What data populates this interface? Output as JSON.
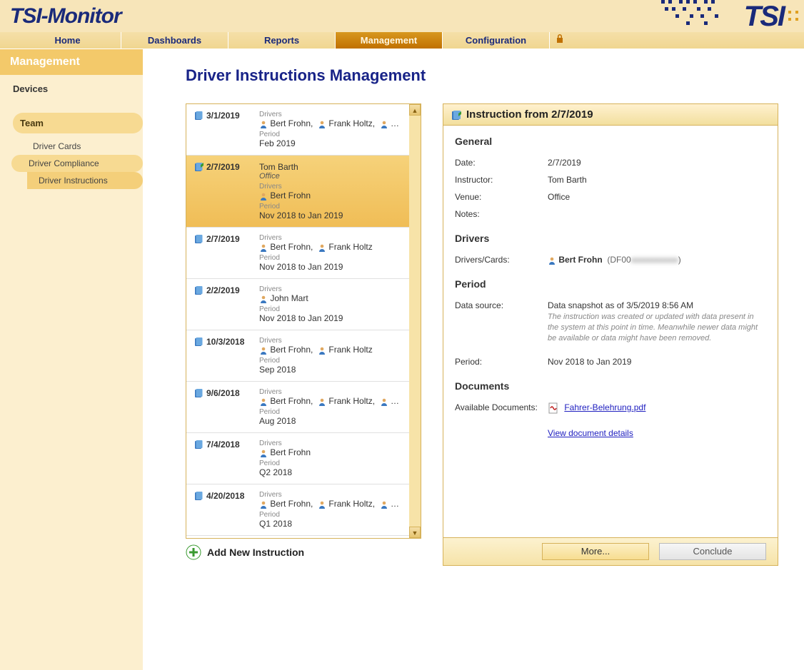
{
  "app": {
    "title": "TSI-Monitor",
    "logo_text": "TSI"
  },
  "nav": {
    "home": "Home",
    "dashboards": "Dashboards",
    "reports": "Reports",
    "management": "Management",
    "configuration": "Configuration"
  },
  "sidebar": {
    "heading": "Management",
    "devices": "Devices",
    "team": "Team",
    "driver_cards": "Driver Cards",
    "driver_compliance": "Driver Compliance",
    "driver_instructions": "Driver Instructions"
  },
  "page": {
    "title": "Driver Instructions Management"
  },
  "list": {
    "drivers_label": "Drivers",
    "period_label": "Period",
    "items": [
      {
        "date": "3/1/2019",
        "drivers": "Bert Frohn,   Frank Holtz,   …",
        "period": "Feb 2019"
      },
      {
        "date": "2/7/2019",
        "instructor": "Tom Barth",
        "venue": "Office",
        "drivers": "Bert Frohn",
        "period": "Nov 2018 to Jan 2019",
        "selected": true
      },
      {
        "date": "2/7/2019",
        "drivers": "Bert Frohn,   Frank Holtz",
        "period": "Nov 2018 to Jan 2019"
      },
      {
        "date": "2/2/2019",
        "drivers": "John Mart",
        "period": "Nov 2018 to Jan 2019"
      },
      {
        "date": "10/3/2018",
        "drivers": "Bert Frohn,   Frank Holtz",
        "period": "Sep 2018"
      },
      {
        "date": "9/6/2018",
        "drivers": "Bert Frohn,   Frank Holtz,   …",
        "period": "Aug 2018"
      },
      {
        "date": "7/4/2018",
        "drivers": "Bert Frohn",
        "period": "Q2 2018"
      },
      {
        "date": "4/20/2018",
        "drivers": "Bert Frohn,   Frank Holtz,   …",
        "period": "Q1 2018"
      }
    ],
    "add_label": "Add New Instruction"
  },
  "detail": {
    "title": "Instruction from 2/7/2019",
    "general_heading": "General",
    "date_label": "Date:",
    "date_value": "2/7/2019",
    "instructor_label": "Instructor:",
    "instructor_value": "Tom Barth",
    "venue_label": "Venue:",
    "venue_value": "Office",
    "notes_label": "Notes:",
    "notes_value": "",
    "drivers_heading": "Drivers",
    "driverscards_label": "Drivers/Cards:",
    "driver_name": "Bert Frohn",
    "driver_card": "(DF00xxxxxxxxxxx)",
    "period_heading": "Period",
    "datasource_label": "Data source:",
    "datasource_value": "Data snapshot as of 3/5/2019 8:56 AM",
    "datasource_hint": "The instruction was created or updated with data present in the system at this point in time. Meanwhile newer data might be available or data might have been removed.",
    "period_label": "Period:",
    "period_value": "Nov 2018 to Jan 2019",
    "documents_heading": "Documents",
    "available_label": "Available Documents:",
    "doc_name": "Fahrer-Belehrung.pdf",
    "view_details": "View document details",
    "btn_more": "More...",
    "btn_conclude": "Conclude"
  }
}
